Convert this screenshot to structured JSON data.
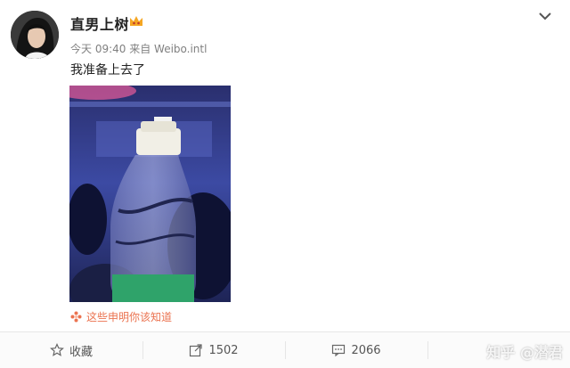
{
  "post": {
    "username": "直男上树",
    "meta": "今天 09:40 来自 Weibo.intl",
    "text": "我准备上去了",
    "notice": "这些申明你该知道"
  },
  "icons": {
    "badge": "vip-crown-icon",
    "menu": "chevron-down-icon",
    "notice": "flower-icon",
    "favorite": "star-icon",
    "repost": "share-arrow-icon",
    "comment": "comment-bubble-icon"
  },
  "actions": {
    "favorite_label": "收藏",
    "repost_count": "1502",
    "comment_count": "2066"
  },
  "watermark": "知乎 @潜君",
  "colors": {
    "notice": "#eb7350",
    "username": "#222222",
    "meta": "#808080"
  }
}
